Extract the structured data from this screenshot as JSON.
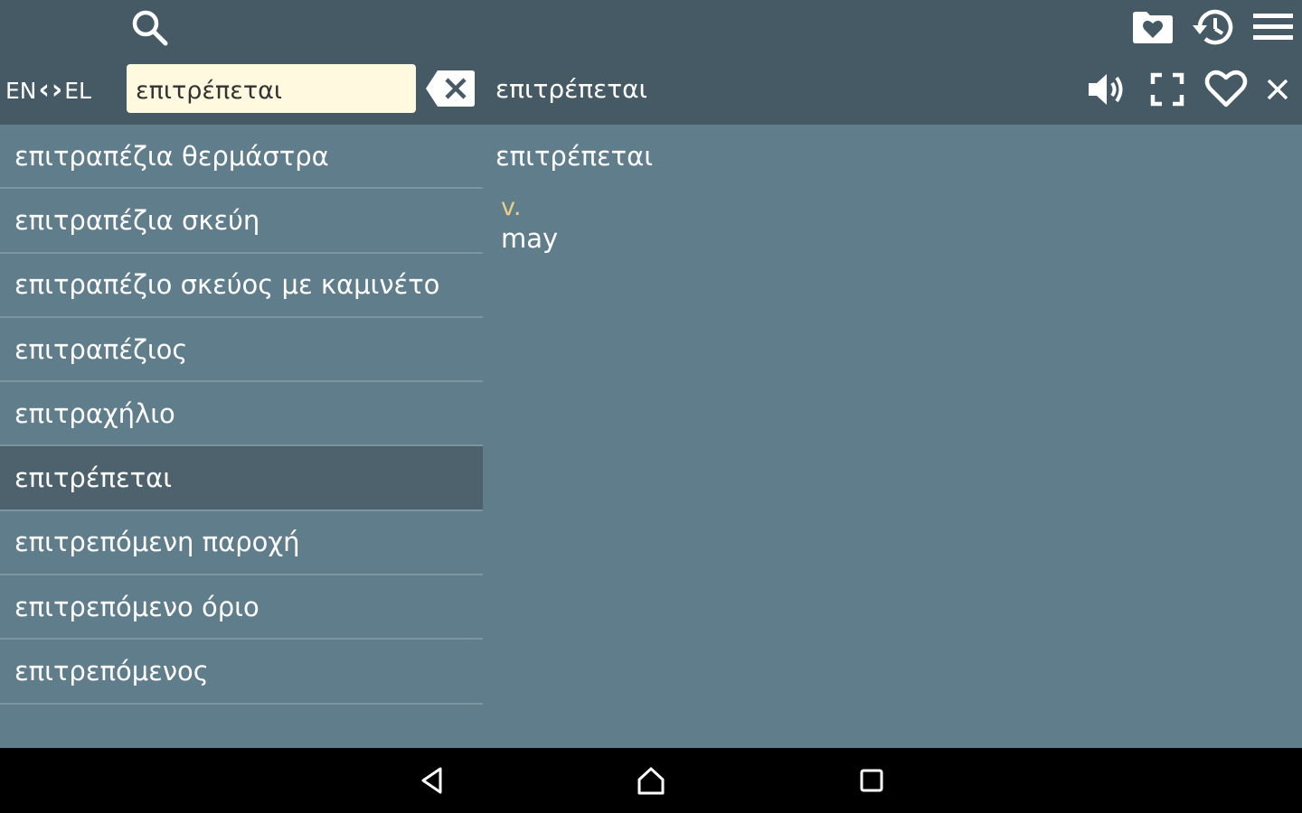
{
  "toolbar": {
    "source_lang": "EN",
    "target_lang": "EL",
    "search_value": "επιτρέπεται",
    "search_placeholder": "",
    "icons": [
      "search-icon",
      "favorites-folder-icon",
      "history-icon",
      "menu-icon",
      "clear-input-icon",
      "speaker-icon",
      "fullscreen-icon",
      "heart-icon",
      "close-icon"
    ]
  },
  "header": {
    "word": "επιτρέπεται"
  },
  "word_list": [
    {
      "label": "επιτραπέζια θερμάστρα",
      "selected": false
    },
    {
      "label": "επιτραπέζια σκεύη",
      "selected": false
    },
    {
      "label": "επιτραπέζιο σκεύος με καμινέτο",
      "selected": false
    },
    {
      "label": "επιτραπέζιος",
      "selected": false
    },
    {
      "label": "επιτραχήλιο",
      "selected": false
    },
    {
      "label": "επιτρέπεται",
      "selected": true
    },
    {
      "label": "επιτρεπόμενη παροχή",
      "selected": false
    },
    {
      "label": "επιτρεπόμενο όριο",
      "selected": false
    },
    {
      "label": "επιτρεπόμενος",
      "selected": false
    }
  ],
  "detail": {
    "word": "επιτρέπεται",
    "part_of_speech": "v.",
    "translation": "may"
  },
  "navbar": {
    "icons": [
      "back-icon",
      "home-icon",
      "recents-icon"
    ]
  },
  "colors": {
    "toolbar_bg": "#455a64",
    "content_bg": "#607d8b",
    "selected_bg": "#4d626d",
    "input_bg": "#fff9e0",
    "pos_color": "#e8d08a"
  }
}
